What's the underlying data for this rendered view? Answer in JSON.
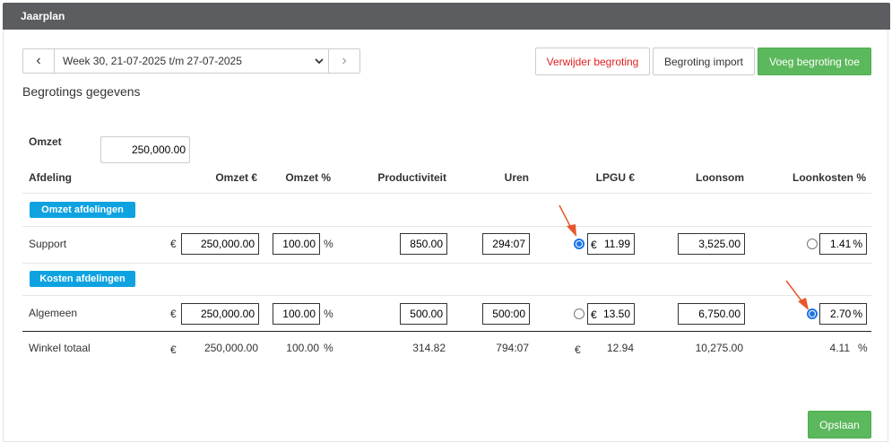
{
  "panel": {
    "title": "Jaarplan"
  },
  "nav": {
    "prev": "‹",
    "next": "›",
    "week": "Week 30, 21-07-2025 t/m 27-07-2025"
  },
  "actions": {
    "delete": "Verwijder begroting",
    "import": "Begroting import",
    "add": "Voeg begroting toe",
    "save": "Opslaan"
  },
  "section_title": "Begrotings gegevens",
  "omzet": {
    "label": "Omzet",
    "value": "250,000.00"
  },
  "columns": [
    "Afdeling",
    "Omzet €",
    "Omzet %",
    "Productiviteit",
    "Uren",
    "LPGU €",
    "Loonsom",
    "Loonkosten %"
  ],
  "groups": {
    "revenue": "Omzet afdelingen",
    "cost": "Kosten afdelingen"
  },
  "currency": "€",
  "pct": "%",
  "rows": {
    "support": {
      "name": "Support",
      "omzet": "250,000.00",
      "omzet_pct": "100.00",
      "productiviteit": "850.00",
      "uren": "294:07",
      "lpgu": "11.99",
      "loonsom": "3,525.00",
      "loonkosten": "1.41",
      "lpgu_selected": true,
      "loonkosten_selected": false
    },
    "algemeen": {
      "name": "Algemeen",
      "omzet": "250,000.00",
      "omzet_pct": "100.00",
      "productiviteit": "500.00",
      "uren": "500:00",
      "lpgu": "13.50",
      "loonsom": "6,750.00",
      "loonkosten": "2.70",
      "lpgu_selected": false,
      "loonkosten_selected": true
    }
  },
  "total": {
    "name": "Winkel totaal",
    "omzet": "250,000.00",
    "omzet_pct": "100.00",
    "productiviteit": "314.82",
    "uren": "794:07",
    "lpgu": "12.94",
    "loonsom": "10,275.00",
    "loonkosten": "4.11"
  },
  "colors": {
    "header": "#5b5d60",
    "tag": "#0ea3e0",
    "green": "#5cb85c",
    "red": "#e02020",
    "radio": "#1a73e8",
    "arrow": "#e8562a"
  }
}
